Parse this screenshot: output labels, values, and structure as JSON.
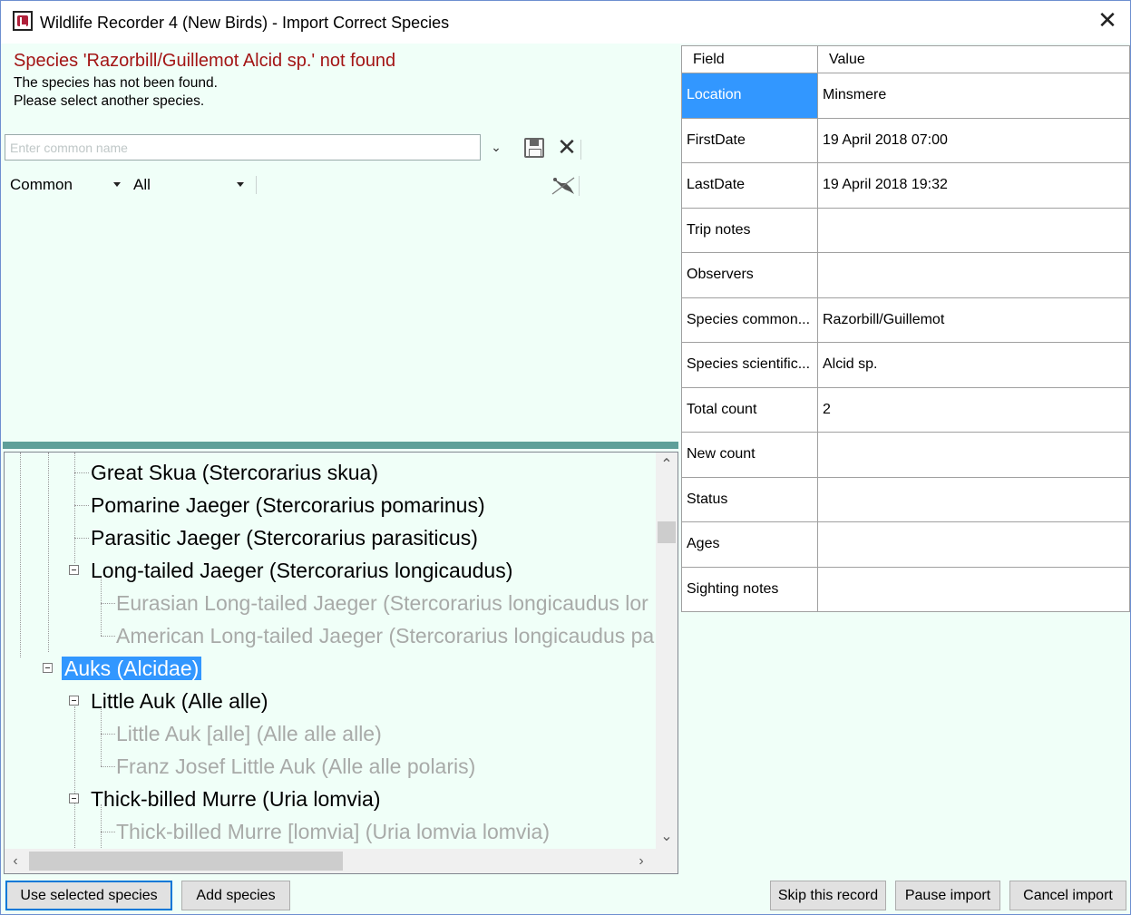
{
  "window": {
    "title": "Wildlife Recorder 4 (New Birds) - Import Correct Species"
  },
  "message": {
    "title": "Species 'Razorbill/Guillemot Alcid sp.' not found",
    "line1": "The species has not been found.",
    "line2": "Please select another species."
  },
  "search": {
    "placeholder": "Enter common name",
    "value": ""
  },
  "filters": {
    "name_type": "Common",
    "group": "All"
  },
  "tree": {
    "items": [
      {
        "label": "Great Skua (Stercorarius skua)",
        "level": 2,
        "sub": false
      },
      {
        "label": "Pomarine Jaeger (Stercorarius pomarinus)",
        "level": 2,
        "sub": false
      },
      {
        "label": "Parasitic Jaeger (Stercorarius parasiticus)",
        "level": 2,
        "sub": false
      },
      {
        "label": "Long-tailed Jaeger (Stercorarius longicaudus)",
        "level": 2,
        "sub": false,
        "expanded": true
      },
      {
        "label": "Eurasian Long-tailed Jaeger (Stercorarius longicaudus lor",
        "level": 3,
        "sub": true
      },
      {
        "label": "American Long-tailed Jaeger (Stercorarius longicaudus pa",
        "level": 3,
        "sub": true
      },
      {
        "label": "Auks (Alcidae)",
        "level": 1,
        "sub": false,
        "selected": true,
        "expanded": true
      },
      {
        "label": "Little Auk (Alle alle)",
        "level": 2,
        "sub": false,
        "expanded": true
      },
      {
        "label": "Little Auk [alle] (Alle alle alle)",
        "level": 3,
        "sub": true
      },
      {
        "label": "Franz Josef Little Auk (Alle alle polaris)",
        "level": 3,
        "sub": true
      },
      {
        "label": "Thick-billed Murre (Uria lomvia)",
        "level": 2,
        "sub": false,
        "expanded": true
      },
      {
        "label": "Thick-billed Murre [lomvia] (Uria lomvia lomvia)",
        "level": 3,
        "sub": true
      }
    ]
  },
  "grid": {
    "header": {
      "field": "Field",
      "value": "Value"
    },
    "rows": [
      {
        "field": "Location",
        "value": "Minsmere"
      },
      {
        "field": "FirstDate",
        "value": "19 April 2018 07:00"
      },
      {
        "field": "LastDate",
        "value": "19 April 2018 19:32"
      },
      {
        "field": "Trip notes",
        "value": ""
      },
      {
        "field": "Observers",
        "value": ""
      },
      {
        "field": "Species common...",
        "value": "Razorbill/Guillemot"
      },
      {
        "field": "Species scientific...",
        "value": "Alcid sp."
      },
      {
        "field": "Total count",
        "value": "2"
      },
      {
        "field": "New count",
        "value": ""
      },
      {
        "field": "Status",
        "value": ""
      },
      {
        "field": "Ages",
        "value": ""
      },
      {
        "field": "Sighting notes",
        "value": ""
      }
    ]
  },
  "buttons": {
    "use_selected": "Use selected species",
    "add_species": "Add species",
    "skip": "Skip this record",
    "pause": "Pause import",
    "cancel": "Cancel import"
  },
  "icons": {
    "app": "wildlife-recorder-app-icon",
    "close": "close-icon",
    "save": "save-icon",
    "clear": "clear-icon",
    "filter": "bird-filter-icon"
  },
  "colors": {
    "background": "#f0fff8",
    "error_text": "#a31515",
    "selection": "#3297ff",
    "splitter": "#5f9f99"
  }
}
